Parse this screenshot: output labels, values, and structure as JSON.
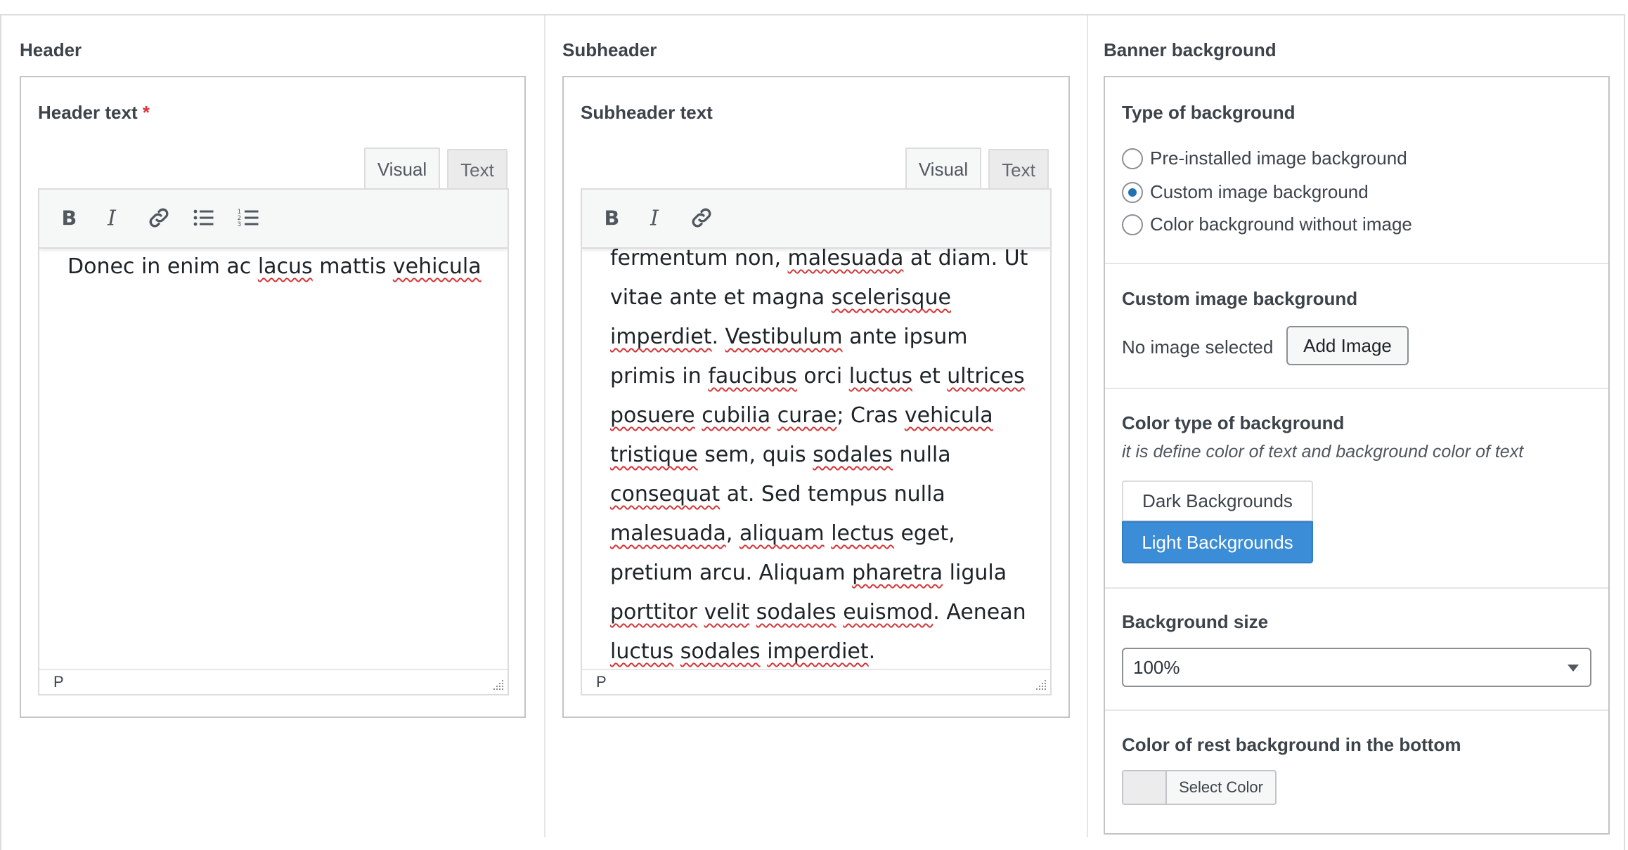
{
  "header_section": {
    "title": "Header",
    "field_label": "Header text",
    "required_mark": "*",
    "tabs": {
      "visual": "Visual",
      "text": "Text"
    },
    "toolbar": [
      "bold-icon",
      "italic-icon",
      "link-icon",
      "bullet-list-icon",
      "numbered-list-icon"
    ],
    "content": {
      "w1": "Donec in enim ac ",
      "s1": "lacus",
      "w2": " mattis ",
      "s2": "vehicula"
    },
    "status_path": "P"
  },
  "subheader_section": {
    "title": "Subheader",
    "field_label": "Subheader text",
    "tabs": {
      "visual": "Visual",
      "text": "Text"
    },
    "toolbar": [
      "bold-icon",
      "italic-icon",
      "link-icon"
    ],
    "lines": [
      [
        {
          "t": "fermentum non, "
        },
        {
          "t": "malesuada",
          "s": true
        },
        {
          "t": " at diam. Ut"
        }
      ],
      [
        {
          "t": "vitae ante et magna "
        },
        {
          "t": "scelerisque",
          "s": true
        }
      ],
      [
        {
          "t": "imperdiet",
          "s": true
        },
        {
          "t": ". "
        },
        {
          "t": "Vestibulum",
          "s": true
        },
        {
          "t": " ante ipsum"
        }
      ],
      [
        {
          "t": "primis in "
        },
        {
          "t": "faucibus",
          "s": true
        },
        {
          "t": " orci "
        },
        {
          "t": "luctus",
          "s": true
        },
        {
          "t": " et "
        },
        {
          "t": "ultrices",
          "s": true
        }
      ],
      [
        {
          "t": "posuere",
          "s": true
        },
        {
          "t": " "
        },
        {
          "t": "cubilia",
          "s": true
        },
        {
          "t": " "
        },
        {
          "t": "curae",
          "s": true
        },
        {
          "t": "; Cras "
        },
        {
          "t": "vehicula",
          "s": true
        }
      ],
      [
        {
          "t": "tristique",
          "s": true
        },
        {
          "t": " sem, quis "
        },
        {
          "t": "sodales",
          "s": true
        },
        {
          "t": " nulla"
        }
      ],
      [
        {
          "t": "consequat",
          "s": true
        },
        {
          "t": " at. Sed tempus nulla"
        }
      ],
      [
        {
          "t": "malesuada",
          "s": true
        },
        {
          "t": ", "
        },
        {
          "t": "aliquam",
          "s": true
        },
        {
          "t": " "
        },
        {
          "t": "lectus",
          "s": true
        },
        {
          "t": " eget,"
        }
      ],
      [
        {
          "t": "pretium arcu. Aliquam "
        },
        {
          "t": "pharetra",
          "s": true
        },
        {
          "t": " ligula"
        }
      ],
      [
        {
          "t": "porttitor",
          "s": true
        },
        {
          "t": " "
        },
        {
          "t": "velit",
          "s": true
        },
        {
          "t": " "
        },
        {
          "t": "sodales",
          "s": true
        },
        {
          "t": " "
        },
        {
          "t": "euismod",
          "s": true
        },
        {
          "t": ". Aenean"
        }
      ],
      [
        {
          "t": "luctus",
          "s": true
        },
        {
          "t": " "
        },
        {
          "t": "sodales",
          "s": true
        },
        {
          "t": " "
        },
        {
          "t": "imperdiet",
          "s": true
        },
        {
          "t": "."
        }
      ]
    ],
    "status_path": "P"
  },
  "banner_section": {
    "title": "Banner background",
    "type_label": "Type of background",
    "radio_options": [
      {
        "label": "Pre-installed image background",
        "checked": false
      },
      {
        "label": "Custom image background",
        "checked": true
      },
      {
        "label": "Color background without image",
        "checked": false
      }
    ],
    "custom_image_label": "Custom image background",
    "no_image_text": "No image selected",
    "add_image_button": "Add Image",
    "color_type_label": "Color type of background",
    "color_type_desc": "it is define color of text and background color of text",
    "dark_option": "Dark Backgrounds",
    "light_option": "Light Backgrounds",
    "size_label": "Background size",
    "size_value": "100%",
    "rest_color_label": "Color of rest background in the bottom",
    "select_color_button": "Select Color",
    "accent_color": "#3a8dd6"
  }
}
